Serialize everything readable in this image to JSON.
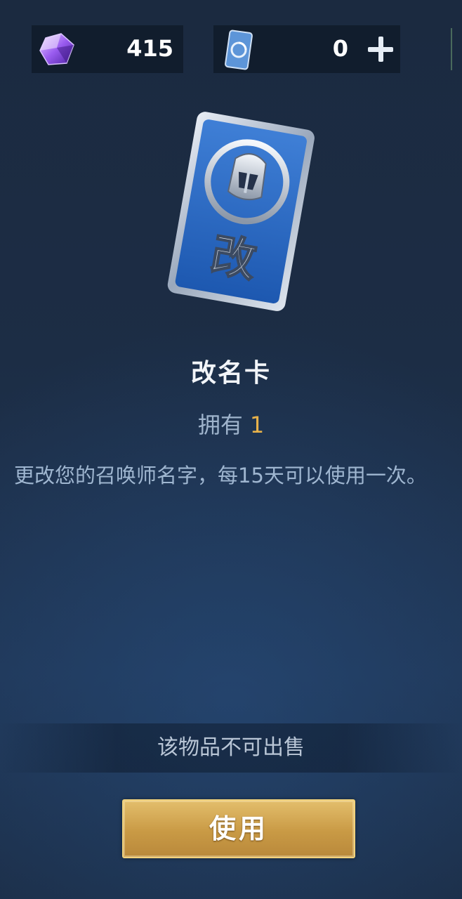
{
  "currency": {
    "gem": {
      "icon": "diamond-gem-icon",
      "value": "415"
    },
    "rename_card": {
      "icon": "rename-card-icon",
      "value": "0"
    }
  },
  "item": {
    "card_glyph": "改",
    "name": "改名卡",
    "owned_label": "拥有",
    "owned_count": "1",
    "description": "更改您的召唤师名字，每15天可以使用一次。"
  },
  "notice": "该物品不可出售",
  "actions": {
    "use_label": "使用"
  },
  "colors": {
    "accent_gold": "#e8b24a",
    "button_gold": "#c99a45",
    "card_blue": "#2f6fc4"
  }
}
